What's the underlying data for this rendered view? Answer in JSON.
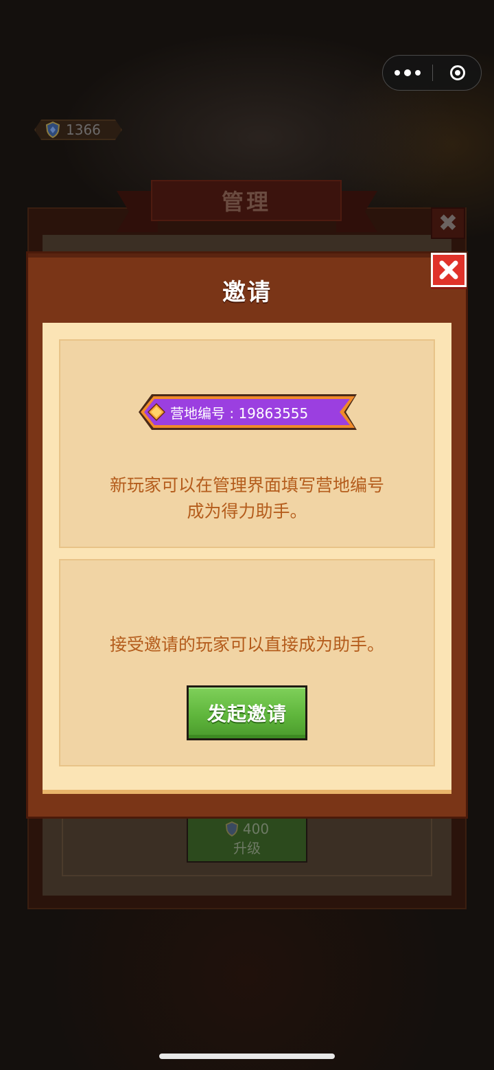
{
  "topbar": {
    "more_icon": "more-dots-icon",
    "close_icon": "mini-program-close-icon"
  },
  "background": {
    "currency_value": "1366",
    "panel_title": "管理",
    "upgrade_cost": "400",
    "upgrade_label": "升级",
    "close_symbol": "✖"
  },
  "dialog": {
    "title": "邀请",
    "close_icon": "close-x-icon",
    "camp_id_label": "营地编号 : 19863555",
    "card1_text_line1": "新玩家可以在管理界面填写营地编号",
    "card1_text_line2": "成为得力助手。",
    "card2_text": "接受邀请的玩家可以直接成为助手。",
    "invite_button": "发起邀请"
  },
  "colors": {
    "dialog_frame": "#7a3517",
    "dialog_body": "#fbe4b5",
    "card": "#f1d4a4",
    "text_brown": "#b45c1c",
    "close_red": "#e0322a",
    "button_green": "#5fb63c",
    "tag_purple": "#9b3fe0",
    "tag_orange": "#f08a2a"
  }
}
